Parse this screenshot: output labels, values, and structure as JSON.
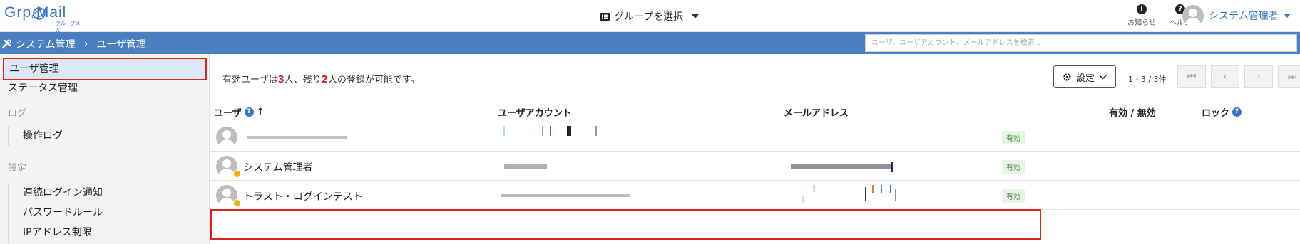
{
  "header": {
    "logo_text": "Grp Mail",
    "logo_sub": "グループメール",
    "group_select_label": "グループを選択",
    "notifications_label": "お知らせ",
    "help_label": "ヘルプ",
    "user_name": "システム管理者"
  },
  "breadcrumb": {
    "root": "システム管理",
    "current": "ユーザ管理"
  },
  "search": {
    "placeholder": "ユーザ、ユーザアカウント、メールアドレスを検索..."
  },
  "sidebar": {
    "items": [
      {
        "label": "ユーザ管理"
      },
      {
        "label": "ステータス管理"
      }
    ],
    "section_log": "ログ",
    "log_items": [
      {
        "label": "操作ログ"
      }
    ],
    "section_settings": "設定",
    "settings_items": [
      {
        "label": "連続ログイン通知"
      },
      {
        "label": "パスワードルール"
      },
      {
        "label": "IPアドレス制限"
      }
    ]
  },
  "main": {
    "info_prefix": "有効ユーザは",
    "info_count": "3",
    "info_mid": "人、残り",
    "info_remaining": "2",
    "info_suffix": "人の登録が可能です。",
    "settings_label": "設定",
    "pager_text": "1 - 3 / 3件"
  },
  "table": {
    "columns": [
      "ユーザ",
      "ユーザアカウント",
      "メールアドレス",
      "有効 / 無効",
      "ロック"
    ],
    "rows": [
      {
        "user": "",
        "status": "有効"
      },
      {
        "user": "システム管理者",
        "status": "有効"
      },
      {
        "user": "トラスト・ログインテスト",
        "status": "有効"
      }
    ]
  },
  "colors": {
    "accent": "#4a7fc1",
    "highlight": "#e02020",
    "status_ok_bg": "#e8f5e5"
  }
}
